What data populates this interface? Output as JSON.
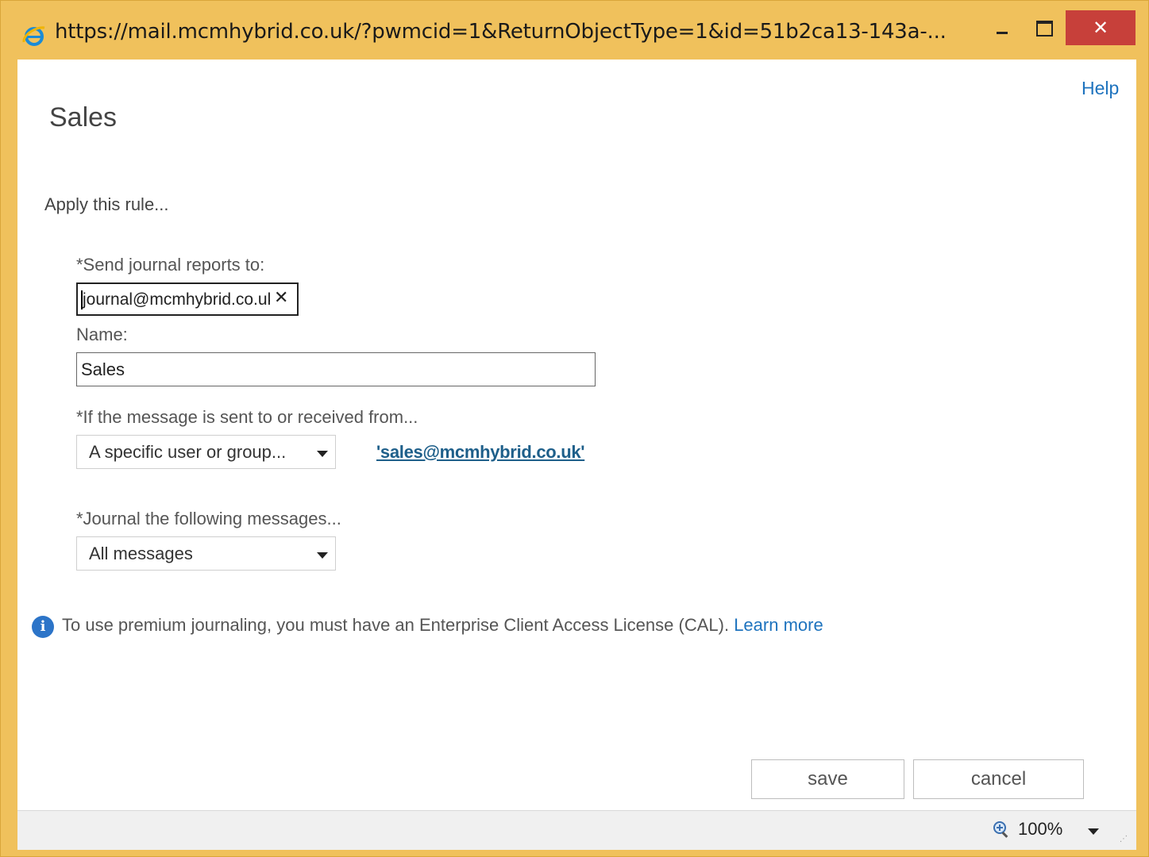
{
  "window": {
    "title_url": "https://mail.mcmhybrid.co.uk/?pwmcid=1&ReturnObjectType=1&id=51b2ca13-143a-...",
    "close_glyph": "✕",
    "frame_color": "#f0c15c",
    "close_color": "#c7403a",
    "icons": {
      "browser": "internet-explorer-icon",
      "minimize": "minimize-icon",
      "maximize": "maximize-icon",
      "close": "close-icon"
    }
  },
  "header": {
    "help_label": "Help",
    "page_title": "Sales"
  },
  "form": {
    "apply_rule": "Apply this rule...",
    "send_reports_label": "*Send journal reports to:",
    "recipient_value": "journal@mcmhybrid.co.uk",
    "recipient_remove": "✕",
    "name_label": "Name:",
    "name_value": "Sales",
    "condition_label": "*If the message is sent to or received from...",
    "condition_selected": "A specific user or group...",
    "condition_value_link": "'sales@mcmhybrid.co.uk'",
    "journal_label": "*Journal the following messages...",
    "journal_selected": "All messages"
  },
  "info": {
    "icon_glyph": "i",
    "message": "To use premium journaling, you must have an Enterprise Client Access License (CAL).",
    "learn_more": "Learn more"
  },
  "actions": {
    "save_label": "save",
    "cancel_label": "cancel"
  },
  "statusbar": {
    "zoom_level": "100%",
    "zoom_icon": "zoom-icon"
  },
  "colors": {
    "link": "#1e73be",
    "info_icon": "#2c74c8"
  }
}
